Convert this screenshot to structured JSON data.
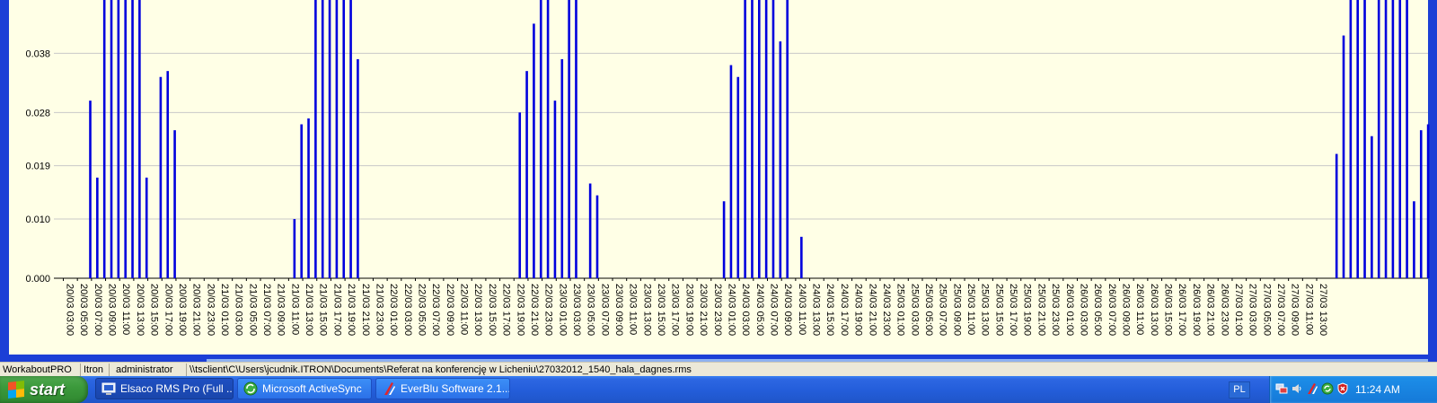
{
  "chart_data": {
    "type": "bar",
    "y_ticks": [
      "0.000",
      "0.010",
      "0.019",
      "0.028",
      "0.038"
    ],
    "ylim": [
      0,
      0.047
    ],
    "grid": true,
    "bar_color": "#0000dd",
    "x_ticks": [
      "20/03 03:00",
      "20/03 05:00",
      "20/03 07:00",
      "20/03 09:00",
      "20/03 11:00",
      "20/03 13:00",
      "20/03 15:00",
      "20/03 17:00",
      "20/03 19:00",
      "20/03 21:00",
      "20/03 23:00",
      "21/03 01:00",
      "21/03 03:00",
      "21/03 05:00",
      "21/03 07:00",
      "21/03 09:00",
      "21/03 11:00",
      "21/03 13:00",
      "21/03 15:00",
      "21/03 17:00",
      "21/03 19:00",
      "21/03 21:00",
      "21/03 23:00",
      "22/03 01:00",
      "22/03 03:00",
      "22/03 05:00",
      "22/03 07:00",
      "22/03 09:00",
      "22/03 11:00",
      "22/03 13:00",
      "22/03 15:00",
      "22/03 17:00",
      "22/03 19:00",
      "22/03 21:00",
      "22/03 23:00",
      "23/03 01:00",
      "23/03 03:00",
      "23/03 05:00",
      "23/03 07:00",
      "23/03 09:00",
      "23/03 11:00",
      "23/03 13:00",
      "23/03 15:00",
      "23/03 17:00",
      "23/03 19:00",
      "23/03 21:00",
      "23/03 23:00",
      "24/03 01:00",
      "24/03 03:00",
      "24/03 05:00",
      "24/03 07:00",
      "24/03 09:00",
      "24/03 11:00",
      "24/03 13:00",
      "24/03 15:00",
      "24/03 17:00",
      "24/03 19:00",
      "24/03 21:00",
      "24/03 23:00",
      "25/03 01:00",
      "25/03 03:00",
      "25/03 05:00",
      "25/03 07:00",
      "25/03 09:00",
      "25/03 11:00",
      "25/03 13:00",
      "25/03 15:00",
      "25/03 17:00",
      "25/03 19:00",
      "25/03 21:00",
      "25/03 23:00",
      "26/03 01:00",
      "26/03 03:00",
      "26/03 05:00",
      "26/03 07:00",
      "26/03 09:00",
      "26/03 11:00",
      "26/03 13:00",
      "26/03 15:00",
      "26/03 17:00",
      "26/03 19:00",
      "26/03 21:00",
      "26/03 23:00",
      "27/03 01:00",
      "27/03 03:00",
      "27/03 05:00",
      "27/03 07:00",
      "27/03 09:00",
      "27/03 11:00",
      "27/03 13:00"
    ],
    "values": [
      0,
      0,
      0,
      0,
      0,
      0,
      0,
      0,
      0.03,
      0.017,
      0.05,
      0.05,
      0.05,
      0.05,
      0.05,
      0.05,
      0.017,
      0,
      0.034,
      0.035,
      0.025,
      0,
      0,
      0,
      0,
      0,
      0,
      0,
      0,
      0,
      0,
      0,
      0,
      0,
      0,
      0,
      0,
      0.01,
      0.026,
      0.027,
      0.05,
      0.05,
      0.05,
      0.05,
      0.05,
      0.05,
      0.037,
      0,
      0,
      0,
      0,
      0,
      0,
      0,
      0,
      0,
      0,
      0,
      0,
      0,
      0,
      0,
      0,
      0,
      0,
      0,
      0,
      0,
      0,
      0.028,
      0.035,
      0.043,
      0.05,
      0.05,
      0.03,
      0.037,
      0.05,
      0.05,
      0,
      0.016,
      0.014,
      0,
      0,
      0,
      0,
      0,
      0,
      0,
      0,
      0,
      0,
      0,
      0,
      0,
      0,
      0,
      0,
      0,
      0.013,
      0.036,
      0.034,
      0.05,
      0.05,
      0.05,
      0.05,
      0.05,
      0.04,
      0.05,
      0,
      0.007,
      0,
      0,
      0,
      0,
      0,
      0,
      0,
      0,
      0,
      0,
      0,
      0,
      0,
      0,
      0,
      0,
      0,
      0,
      0,
      0,
      0,
      0,
      0,
      0,
      0,
      0,
      0,
      0,
      0,
      0,
      0,
      0,
      0,
      0,
      0,
      0,
      0,
      0,
      0,
      0,
      0,
      0,
      0,
      0,
      0,
      0,
      0,
      0,
      0,
      0,
      0,
      0,
      0,
      0,
      0,
      0,
      0,
      0,
      0,
      0,
      0,
      0,
      0,
      0,
      0,
      0,
      0,
      0,
      0,
      0,
      0,
      0,
      0,
      0,
      0,
      0.021,
      0.041,
      0.05,
      0.05,
      0.05,
      0.024,
      0.05,
      0.05,
      0.05,
      0.05,
      0.05,
      0.013,
      0.025,
      0.026,
      0,
      0,
      0,
      0,
      0,
      0,
      0,
      0,
      0,
      0,
      0,
      0,
      0,
      0,
      0,
      0,
      0,
      0,
      0,
      0,
      0.012,
      0.02,
      0.021,
      0.025,
      0.05,
      0.05,
      0.05,
      0.05,
      0.05
    ]
  },
  "statusbar": {
    "cells": [
      "WorkaboutPRO",
      "Itron",
      "administrator",
      "\\\\tsclient\\C\\Users\\jcudnik.ITRON\\Documents\\Referat na konferencję w Licheniu\\27032012_1540_hala_dagnes.rms"
    ]
  },
  "taskbar": {
    "start_label": "start",
    "tasks": [
      {
        "label": "Elsaco RMS Pro (Full ...",
        "icon": "monitor-icon",
        "active": true
      },
      {
        "label": "Microsoft ActiveSync",
        "icon": "activesync-icon",
        "active": false
      },
      {
        "label": "EverBlu Software 2.1....",
        "icon": "everblu-icon",
        "active": false
      }
    ],
    "language": "PL",
    "clock": "11:24 AM",
    "tray_icons": [
      "network-icon",
      "speaker-icon",
      "everblu-tray-icon",
      "activesync-tray-icon",
      "security-shield-icon"
    ]
  },
  "colors": {
    "chart_background": "#ffffe6",
    "window_border": "#1c3fd6",
    "taskbar": "#245edb",
    "start_button": "#3c9a3c",
    "tray": "#1579d8"
  }
}
